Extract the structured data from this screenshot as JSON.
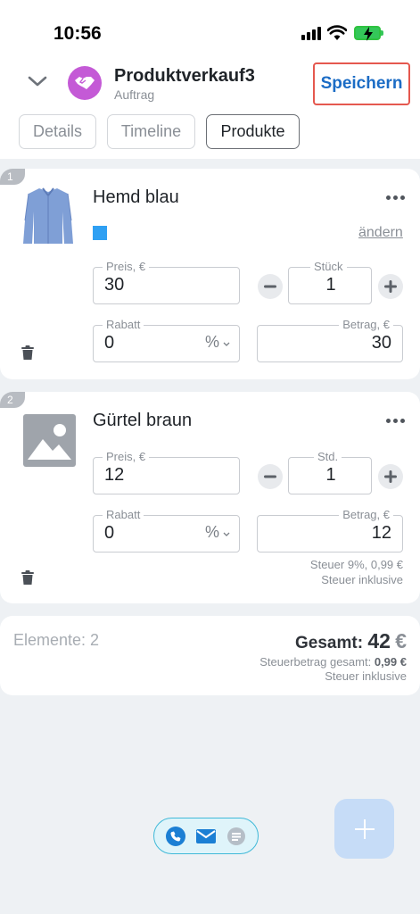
{
  "status": {
    "time": "10:56"
  },
  "header": {
    "title": "Produktverkauf3",
    "subtitle": "Auftrag",
    "save_label": "Speichern"
  },
  "tabs": [
    {
      "label": "Details"
    },
    {
      "label": "Timeline"
    },
    {
      "label": "Produkte"
    }
  ],
  "products": [
    {
      "index": "1",
      "name": "Hemd blau",
      "change_label": "ändern",
      "price_label": "Preis, €",
      "price": "30",
      "qty_label": "Stück",
      "qty": "1",
      "discount_label": "Rabatt",
      "discount": "0",
      "discount_unit": "%",
      "amount_label": "Betrag, €",
      "amount": "30",
      "swatch_color": "#2fa0f3"
    },
    {
      "index": "2",
      "name": "Gürtel braun",
      "price_label": "Preis, €",
      "price": "12",
      "qty_label": "Std.",
      "qty": "1",
      "discount_label": "Rabatt",
      "discount": "0",
      "discount_unit": "%",
      "amount_label": "Betrag, €",
      "amount": "12",
      "tax": "Steuer 9%, 0,99 €",
      "tax_mode": "Steuer inklusive"
    }
  ],
  "summary": {
    "elements": "Elemente: 2",
    "total_label": "Gesamt:",
    "total_value": "42",
    "total_currency": "€",
    "tax_label": "Steuerbetrag gesamt:",
    "tax_value": "0,99 €",
    "tax_mode": "Steuer inklusive"
  },
  "colors": {
    "accent": "#1b6cc5",
    "highlight": "#e5584f",
    "app_avatar": "#c45ad6",
    "fab": "#c6dcf7"
  }
}
